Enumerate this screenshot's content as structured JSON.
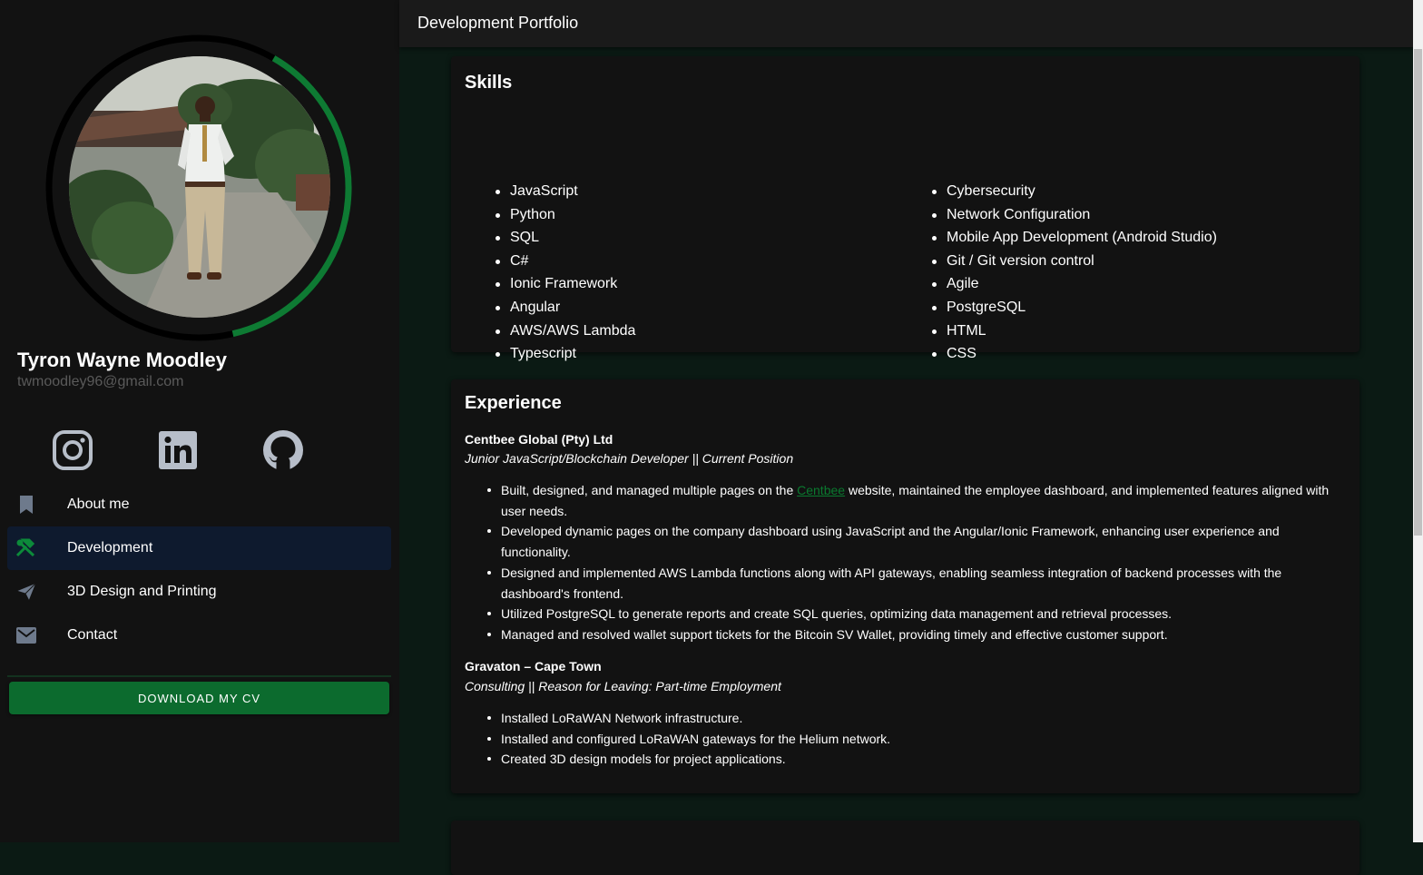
{
  "header": {
    "title": "Development Portfolio"
  },
  "profile": {
    "name": "Tyron Wayne Moodley",
    "email": "twmoodley96@gmail.com",
    "ring_progress": 0.38
  },
  "social": [
    {
      "icon": "instagram-icon"
    },
    {
      "icon": "linkedin-icon"
    },
    {
      "icon": "github-icon"
    }
  ],
  "nav": {
    "items": [
      {
        "label": "About me",
        "icon": "bookmark-icon",
        "active": false
      },
      {
        "label": "Development",
        "icon": "tools-icon",
        "active": true
      },
      {
        "label": "3D Design and Printing",
        "icon": "send-icon",
        "active": false
      },
      {
        "label": "Contact",
        "icon": "mail-icon",
        "active": false
      }
    ]
  },
  "cv_button": {
    "label": "DOWNLOAD MY CV"
  },
  "skills": {
    "title": "Skills",
    "left": [
      "JavaScript",
      "Python",
      "SQL",
      "C#",
      "Ionic Framework",
      "Angular",
      "AWS/AWS Lambda",
      "Typescript"
    ],
    "right": [
      "Cybersecurity",
      "Network Configuration",
      "Mobile App Development (Android Studio)",
      "Git / Git version control",
      "Agile",
      "PostgreSQL",
      "HTML",
      "CSS"
    ]
  },
  "experience": {
    "title": "Experience",
    "jobs": [
      {
        "company": "Centbee Global (Pty) Ltd",
        "role": "Junior JavaScript/Blockchain Developer || Current Position",
        "bullet0": {
          "before": "Built, designed, and managed multiple pages on the ",
          "link": "Centbee",
          "after": " website, maintained the employee dashboard, and implemented features aligned with user needs."
        },
        "bullets": [
          "Developed dynamic pages on the company dashboard using JavaScript and the Angular/Ionic Framework, enhancing user experience and functionality.",
          "Designed and implemented AWS Lambda functions along with API gateways, enabling seamless integration of backend processes with the dashboard's frontend.",
          "Utilized PostgreSQL to generate reports and create SQL queries, optimizing data management and retrieval processes.",
          "Managed and resolved wallet support tickets for the Bitcoin SV Wallet, providing timely and effective customer support."
        ]
      },
      {
        "company": "Gravaton – Cape Town",
        "role": "Consulting || Reason for Leaving: Part-time Employment",
        "bullets": [
          "Installed LoRaWAN Network infrastructure.",
          "Installed and configured LoRaWAN gateways for the Helium network.",
          "Created 3D design models for project applications."
        ]
      }
    ]
  },
  "colors": {
    "accent": "#0c6b2e",
    "ring": "#0e7a33",
    "active_nav": "#0e1a2e",
    "page_bg": "#0b1a14",
    "card_bg": "#121212"
  }
}
